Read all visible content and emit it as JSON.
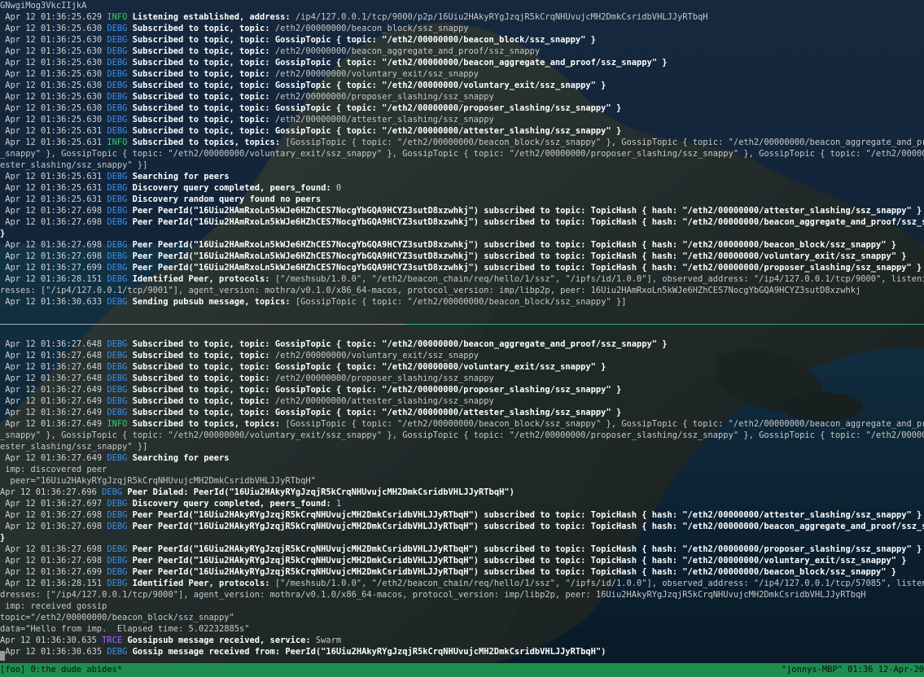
{
  "terminal": {
    "top_pane": [
      {
        "cont": "GNwgiMog3VkcIIjkA"
      },
      {
        "ts": " Apr 12 01:36:25.629",
        "lvl": "INFO",
        "msg": "Listening established, address:",
        "text": " /ip4/127.0.0.1/tcp/9000/p2p/16Uiu2HAkyRYgJzqjR5kCrqNHUvujcMH2DmkCsridbVHLJJyRTbqH"
      },
      {
        "ts": " Apr 12 01:36:25.630",
        "lvl": "DEBG",
        "msg": "Subscribed to topic, topic:",
        "text": " /eth2/00000000/beacon_block/ssz_snappy"
      },
      {
        "ts": " Apr 12 01:36:25.630",
        "lvl": "DEBG",
        "msg": "Subscribed to topic, topic: GossipTopic { topic: \"/eth2/00000000/beacon_block/ssz_snappy\" }",
        "text": ""
      },
      {
        "ts": " Apr 12 01:36:25.630",
        "lvl": "DEBG",
        "msg": "Subscribed to topic, topic:",
        "text": " /eth2/00000000/beacon_aggregate_and_proof/ssz_snappy"
      },
      {
        "ts": " Apr 12 01:36:25.630",
        "lvl": "DEBG",
        "msg": "Subscribed to topic, topic: GossipTopic { topic: \"/eth2/00000000/beacon_aggregate_and_proof/ssz_snappy\" }",
        "text": ""
      },
      {
        "ts": " Apr 12 01:36:25.630",
        "lvl": "DEBG",
        "msg": "Subscribed to topic, topic:",
        "text": " /eth2/00000000/voluntary_exit/ssz_snappy"
      },
      {
        "ts": " Apr 12 01:36:25.630",
        "lvl": "DEBG",
        "msg": "Subscribed to topic, topic: GossipTopic { topic: \"/eth2/00000000/voluntary_exit/ssz_snappy\" }",
        "text": ""
      },
      {
        "ts": " Apr 12 01:36:25.630",
        "lvl": "DEBG",
        "msg": "Subscribed to topic, topic:",
        "text": " /eth2/00000000/proposer_slashing/ssz_snappy"
      },
      {
        "ts": " Apr 12 01:36:25.630",
        "lvl": "DEBG",
        "msg": "Subscribed to topic, topic: GossipTopic { topic: \"/eth2/00000000/proposer_slashing/ssz_snappy\" }",
        "text": ""
      },
      {
        "ts": " Apr 12 01:36:25.630",
        "lvl": "DEBG",
        "msg": "Subscribed to topic, topic:",
        "text": " /eth2/00000000/attester_slashing/ssz_snappy"
      },
      {
        "ts": " Apr 12 01:36:25.631",
        "lvl": "DEBG",
        "msg": "Subscribed to topic, topic: GossipTopic { topic: \"/eth2/00000000/attester_slashing/ssz_snappy\" }",
        "text": ""
      },
      {
        "ts": " Apr 12 01:36:25.631",
        "lvl": "INFO",
        "msg": "Subscribed to topics, topics:",
        "text": " [GossipTopic { topic: \"/eth2/00000000/beacon_block/ssz_snappy\" }, GossipTopic { topic: \"/eth2/00000000/beacon_aggregate_and_proof/ssz"
      },
      {
        "cont": "_snappy\" }, GossipTopic { topic: \"/eth2/00000000/voluntary_exit/ssz_snappy\" }, GossipTopic { topic: \"/eth2/00000000/proposer_slashing/ssz_snappy\" }, GossipTopic { topic: \"/eth2/00000000/att"
      },
      {
        "cont": "ester_slashing/ssz_snappy\" }]"
      },
      {
        "ts": " Apr 12 01:36:25.631",
        "lvl": "DEBG",
        "msg": "Searching for peers",
        "text": ""
      },
      {
        "ts": " Apr 12 01:36:25.631",
        "lvl": "DEBG",
        "msg": "Discovery query completed, peers_found:",
        "text": " 0"
      },
      {
        "ts": " Apr 12 01:36:25.631",
        "lvl": "DEBG",
        "msg": "Discovery random query found no peers",
        "text": ""
      },
      {
        "ts": " Apr 12 01:36:27.698",
        "lvl": "DEBG",
        "msg": "Peer PeerId(\"16Uiu2HAmRxoLn5kWJe6HZhCES7NocgYbGQA9HCYZ3sutD8xzwhkj\") subscribed to topic: TopicHash { hash: \"/eth2/00000000/attester_slashing/ssz_snappy\" }",
        "text": ""
      },
      {
        "ts": " Apr 12 01:36:27.698",
        "lvl": "DEBG",
        "msg": "Peer PeerId(\"16Uiu2HAmRxoLn5kWJe6HZhCES7NocgYbGQA9HCYZ3sutD8xzwhkj\") subscribed to topic: TopicHash { hash: \"/eth2/00000000/beacon_aggregate_and_proof/ssz_snappy\"",
        "text": ""
      },
      {
        "cont": "}",
        "bold": true
      },
      {
        "ts": " Apr 12 01:36:27.698",
        "lvl": "DEBG",
        "msg": "Peer PeerId(\"16Uiu2HAmRxoLn5kWJe6HZhCES7NocgYbGQA9HCYZ3sutD8xzwhkj\") subscribed to topic: TopicHash { hash: \"/eth2/00000000/beacon_block/ssz_snappy\" }",
        "text": ""
      },
      {
        "ts": " Apr 12 01:36:27.698",
        "lvl": "DEBG",
        "msg": "Peer PeerId(\"16Uiu2HAmRxoLn5kWJe6HZhCES7NocgYbGQA9HCYZ3sutD8xzwhkj\") subscribed to topic: TopicHash { hash: \"/eth2/00000000/voluntary_exit/ssz_snappy\" }",
        "text": ""
      },
      {
        "ts": " Apr 12 01:36:27.699",
        "lvl": "DEBG",
        "msg": "Peer PeerId(\"16Uiu2HAmRxoLn5kWJe6HZhCES7NocgYbGQA9HCYZ3sutD8xzwhkj\") subscribed to topic: TopicHash { hash: \"/eth2/00000000/proposer_slashing/ssz_snappy\" }",
        "text": ""
      },
      {
        "ts": " Apr 12 01:36:28.151",
        "lvl": "DEBG",
        "msg": "Identified Peer, protocols:",
        "text": " [\"/meshsub/1.0.0\", \"/eth2/beacon_chain/req/hello/1/ssz\", \"/ipfs/id/1.0.0\"], observed_address: \"/ip4/127.0.0.1/tcp/9000\", listening_ add"
      },
      {
        "cont": "resses: [\"/ip4/127.0.0.1/tcp/9001\"], agent_version: mothra/v0.1.0/x86_64-macos, protocol_version: imp/libp2p, peer: 16Uiu2HAmRxoLn5kWJe6HZhCES7NocgYbGQA9HCYZ3sutD8xzwhkj"
      },
      {
        "ts": " Apr 12 01:36:30.633",
        "lvl": "DEBG",
        "msg": "Sending pubsub message, topics:",
        "text": " [GossipTopic { topic: \"/eth2/00000000/beacon_block/ssz_snappy\" }]"
      }
    ],
    "bottom_pane": [
      {
        "cont": ""
      },
      {
        "ts": " Apr 12 01:36:27.648",
        "lvl": "DEBG",
        "msg": "Subscribed to topic, topic: GossipTopic { topic: \"/eth2/00000000/beacon_aggregate_and_proof/ssz_snappy\" }",
        "text": ""
      },
      {
        "ts": " Apr 12 01:36:27.648",
        "lvl": "DEBG",
        "msg": "Subscribed to topic, topic:",
        "text": " /eth2/00000000/voluntary_exit/ssz_snappy"
      },
      {
        "ts": " Apr 12 01:36:27.648",
        "lvl": "DEBG",
        "msg": "Subscribed to topic, topic: GossipTopic { topic: \"/eth2/00000000/voluntary_exit/ssz_snappy\" }",
        "text": ""
      },
      {
        "ts": " Apr 12 01:36:27.648",
        "lvl": "DEBG",
        "msg": "Subscribed to topic, topic:",
        "text": " /eth2/00000000/proposer_slashing/ssz_snappy"
      },
      {
        "ts": " Apr 12 01:36:27.649",
        "lvl": "DEBG",
        "msg": "Subscribed to topic, topic: GossipTopic { topic: \"/eth2/00000000/proposer_slashing/ssz_snappy\" }",
        "text": ""
      },
      {
        "ts": " Apr 12 01:36:27.649",
        "lvl": "DEBG",
        "msg": "Subscribed to topic, topic:",
        "text": " /eth2/00000000/attester_slashing/ssz_snappy"
      },
      {
        "ts": " Apr 12 01:36:27.649",
        "lvl": "DEBG",
        "msg": "Subscribed to topic, topic: GossipTopic { topic: \"/eth2/00000000/attester_slashing/ssz_snappy\" }",
        "text": ""
      },
      {
        "ts": " Apr 12 01:36:27.649",
        "lvl": "INFO",
        "msg": "Subscribed to topics, topics:",
        "text": " [GossipTopic { topic: \"/eth2/00000000/beacon_block/ssz_snappy\" }, GossipTopic { topic: \"/eth2/00000000/beacon_aggregate_and_proof/ssz"
      },
      {
        "cont": "_snappy\" }, GossipTopic { topic: \"/eth2/00000000/voluntary_exit/ssz_snappy\" }, GossipTopic { topic: \"/eth2/00000000/proposer_slashing/ssz_snappy\" }, GossipTopic { topic: \"/eth2/00000000/att"
      },
      {
        "cont": "ester_slashing/ssz_snappy\" }]"
      },
      {
        "ts": " Apr 12 01:36:27.649",
        "lvl": "DEBG",
        "msg": "Searching for peers",
        "text": ""
      },
      {
        "cont": " imp: discovered peer"
      },
      {
        "cont": "  peer=\"16Uiu2HAkyRYgJzqjR5kCrqNHUvujcMH2DmkCsridbVHLJJyRTbqH\""
      },
      {
        "ts": "Apr 12 01:36:27.696",
        "lvl": "DEBG",
        "msg": "Peer Dialed: PeerId(\"16Uiu2HAkyRYgJzqjR5kCrqNHUvujcMH2DmkCsridbVHLJJyRTbqH\")",
        "text": ""
      },
      {
        "ts": " Apr 12 01:36:27.697",
        "lvl": "DEBG",
        "msg": "Discovery query completed, peers_found:",
        "text": " 1"
      },
      {
        "ts": " Apr 12 01:36:27.698",
        "lvl": "DEBG",
        "msg": "Peer PeerId(\"16Uiu2HAkyRYgJzqjR5kCrqNHUvujcMH2DmkCsridbVHLJJyRTbqH\") subscribed to topic: TopicHash { hash: \"/eth2/00000000/attester_slashing/ssz_snappy\" }",
        "text": ""
      },
      {
        "ts": " Apr 12 01:36:27.698",
        "lvl": "DEBG",
        "msg": "Peer PeerId(\"16Uiu2HAkyRYgJzqjR5kCrqNHUvujcMH2DmkCsridbVHLJJyRTbqH\") subscribed to topic: TopicHash { hash: \"/eth2/00000000/beacon_aggregate_and_proof/ssz_snappy\"",
        "text": ""
      },
      {
        "cont": "}",
        "bold": true
      },
      {
        "ts": " Apr 12 01:36:27.698",
        "lvl": "DEBG",
        "msg": "Peer PeerId(\"16Uiu2HAkyRYgJzqjR5kCrqNHUvujcMH2DmkCsridbVHLJJyRTbqH\") subscribed to topic: TopicHash { hash: \"/eth2/00000000/proposer_slashing/ssz_snappy\" }",
        "text": ""
      },
      {
        "ts": " Apr 12 01:36:27.698",
        "lvl": "DEBG",
        "msg": "Peer PeerId(\"16Uiu2HAkyRYgJzqjR5kCrqNHUvujcMH2DmkCsridbVHLJJyRTbqH\") subscribed to topic: TopicHash { hash: \"/eth2/00000000/voluntary_exit/ssz_snappy\" }",
        "text": ""
      },
      {
        "ts": " Apr 12 01:36:27.699",
        "lvl": "DEBG",
        "msg": "Peer PeerId(\"16Uiu2HAkyRYgJzqjR5kCrqNHUvujcMH2DmkCsridbVHLJJyRTbqH\") subscribed to topic: TopicHash { hash: \"/eth2/00000000/beacon_block/ssz_snappy\" }",
        "text": ""
      },
      {
        "ts": " Apr 12 01:36:28.151",
        "lvl": "DEBG",
        "msg": "Identified Peer, protocols:",
        "text": " [\"/meshsub/1.0.0\", \"/eth2/beacon_chain/req/hello/1/ssz\", \"/ipfs/id/1.0.0\"], observed_address: \"/ip4/127.0.0.1/tcp/57085\", listening_ ad"
      },
      {
        "cont": "dresses: [\"/ip4/127.0.0.1/tcp/9000\"], agent_version: mothra/v0.1.0/x86_64-macos, protocol_version: imp/libp2p, peer: 16Uiu2HAkyRYgJzqjR5kCrqNHUvujcMH2DmkCsridbVHLJJyRTbqH"
      },
      {
        "cont": " imp: received gossip"
      },
      {
        "cont": "topic=\"/eth2/00000000/beacon_block/ssz_snappy\""
      },
      {
        "cont": "data=\"Hello from imp.  Elapsed time: 5.02232885s\""
      },
      {
        "ts": "Apr 12 01:36:30.635",
        "lvl": "TRCE",
        "msg": "Gossipsub message received, service:",
        "text": " Swarm"
      },
      {
        "ts": " Apr 12 01:36:30.635",
        "lvl": "DEBG",
        "msg": "Gossip message received from: PeerId(\"16Uiu2HAkyRYgJzqjR5kCrqNHUvujcMH2DmkCsridbVHLJJyRTbqH\")",
        "text": ""
      }
    ]
  },
  "statusbar": {
    "session": "[foo] ",
    "window": "0:the dude abides*",
    "host": "\"jonnys-MBP\"",
    "time": "01:36",
    "date": "12-Apr-20"
  },
  "colors": {
    "info": "#3cc96a",
    "debug": "#3a8ff0",
    "trace": "#a76bff",
    "status_bar": "#1e8f4e"
  }
}
